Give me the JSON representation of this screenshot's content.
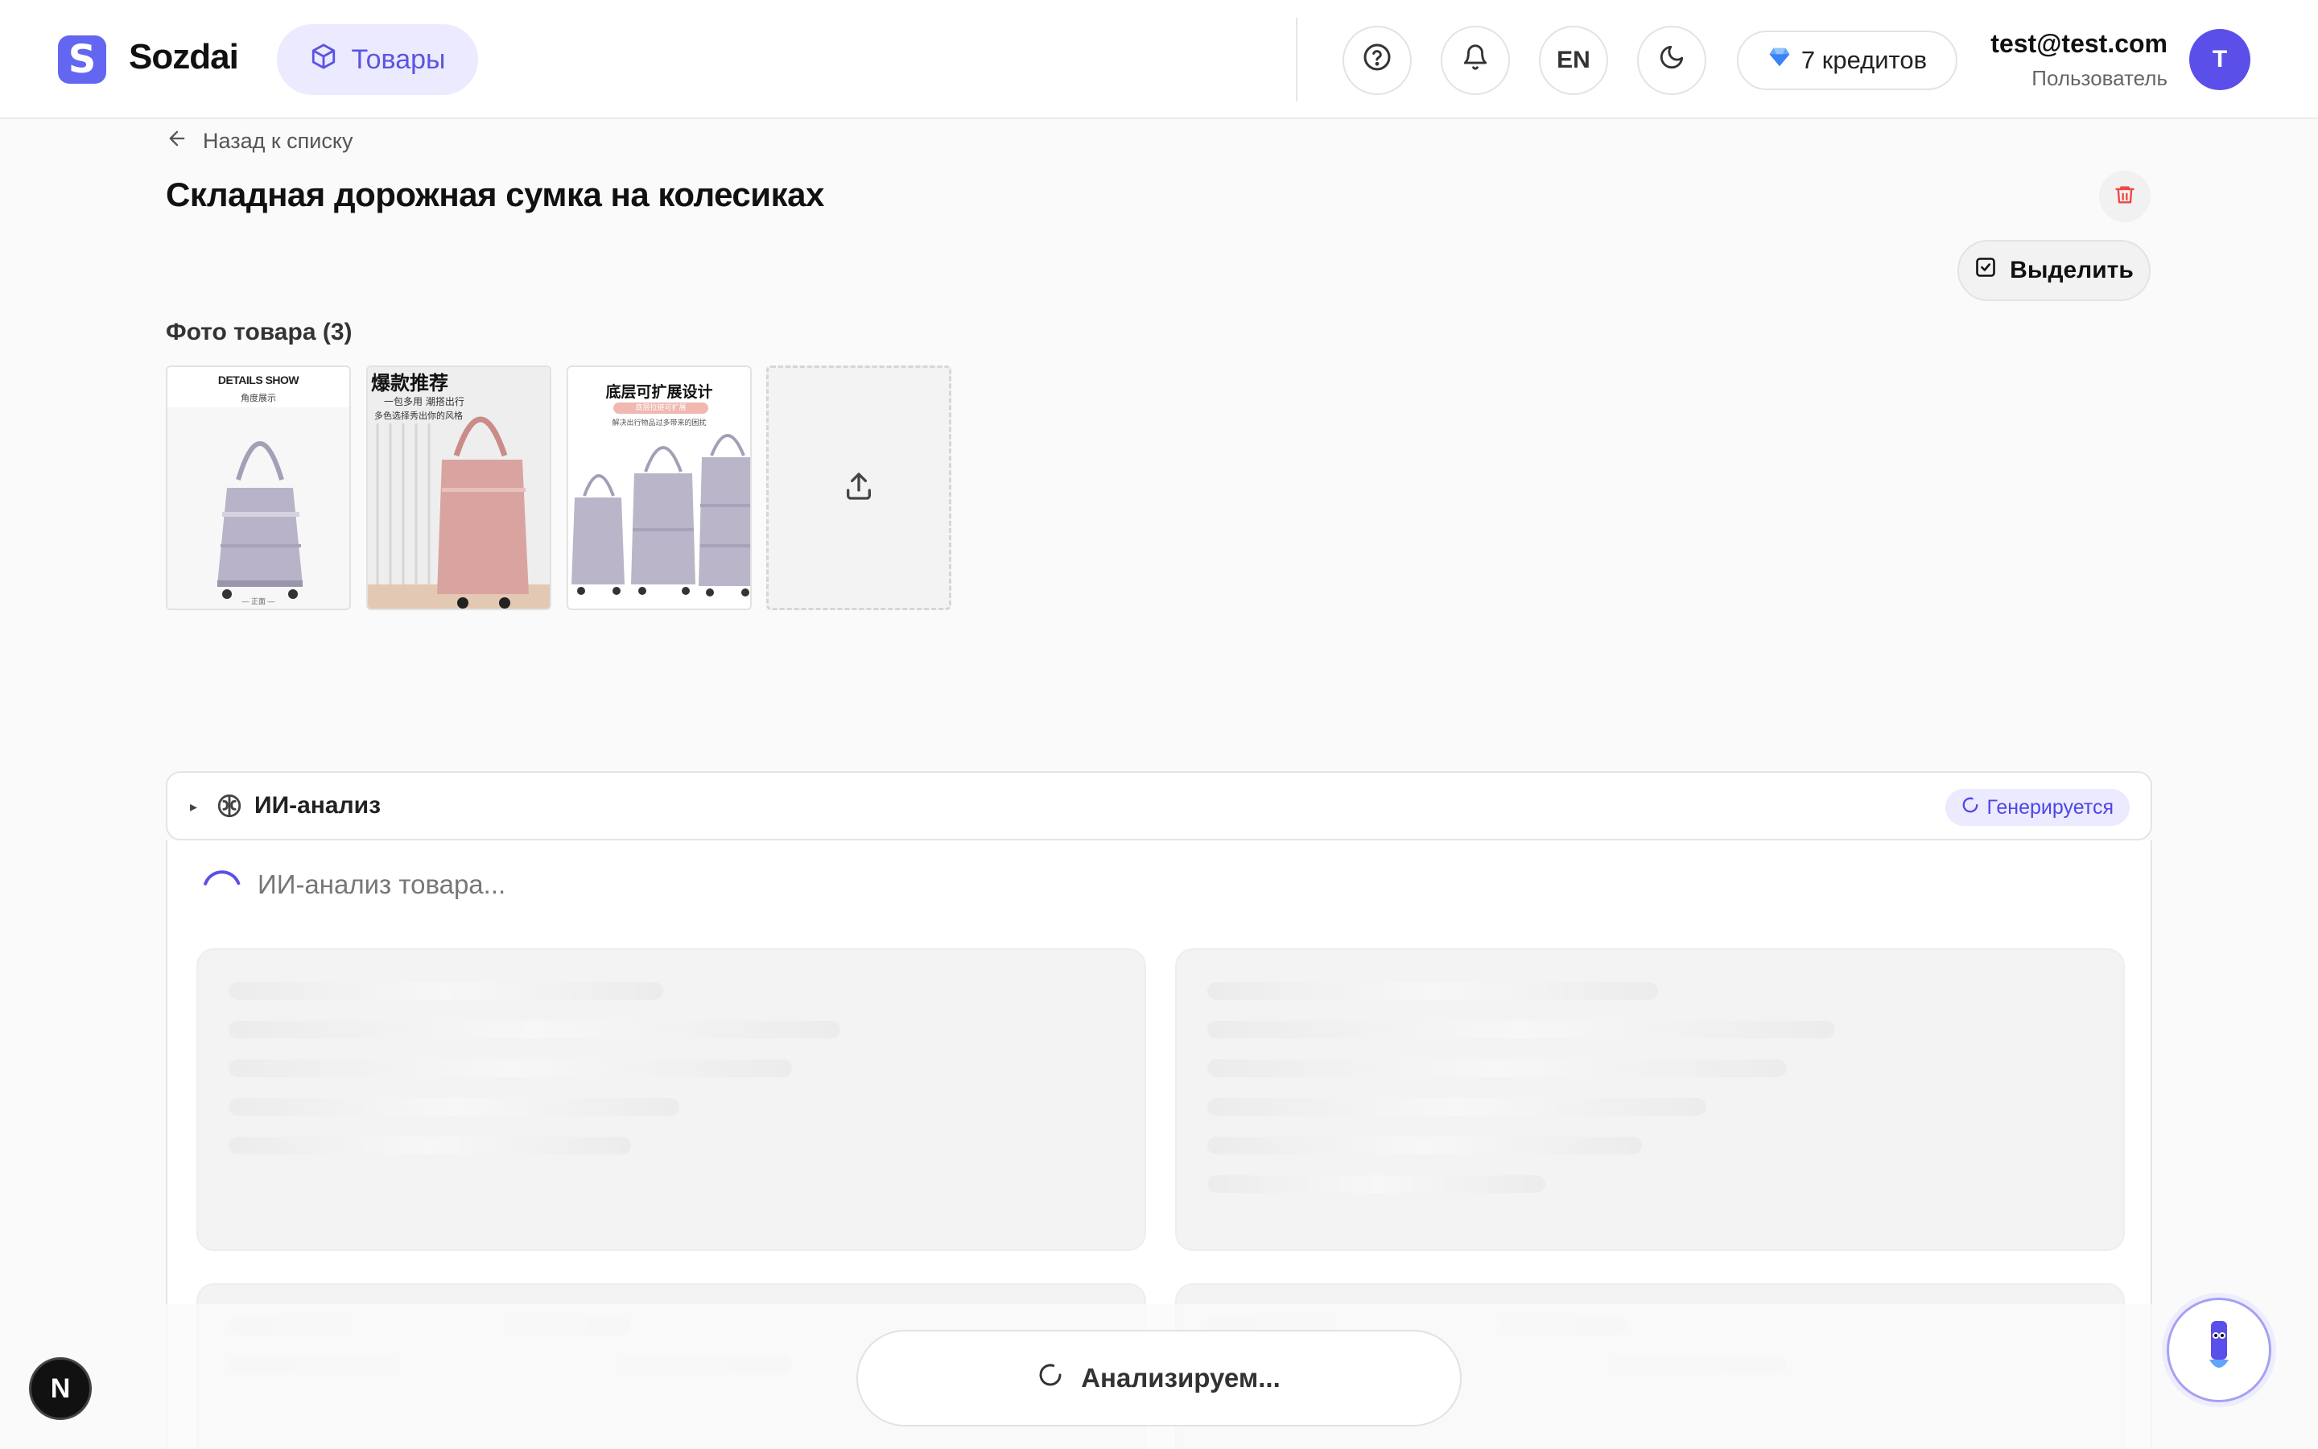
{
  "header": {
    "brand": "Sozdai",
    "logo_letter": "S",
    "nav_item": "Товары",
    "language": "EN",
    "credits": "7 кредитов",
    "user_email": "test@test.com",
    "user_role": "Пользователь",
    "avatar_initial": "T"
  },
  "product": {
    "back_label": "Назад к списку",
    "title": "Складная дорожная сумка на колесиках",
    "select_label": "Выделить",
    "photos_label": "Фото товара (3)",
    "photos": [
      {
        "caption_top": "DETAILS SHOW",
        "caption_sub": "角度展示",
        "caption_bottom": "— 正面 —",
        "bag_color": "#b9b3c9"
      },
      {
        "caption_top": "爆款推荐",
        "caption_sub": "一包多用 潮搭出行",
        "caption_sub2": "多色选择秀出你的风格",
        "bag_color": "#d9a4a0"
      },
      {
        "caption_top": "底层可扩展设计",
        "caption_sub": "底层拉链可扩展",
        "caption_sub2": "解决出行物品过多带来的困扰",
        "bag_color": "#bab5c8"
      }
    ]
  },
  "ai_panel": {
    "title": "ИИ-анализ",
    "status_badge": "Генерируется",
    "loading_text": "ИИ-анализ товара..."
  },
  "bottom": {
    "analyze_label": "Анализируем...",
    "next_badge": "N"
  },
  "colors": {
    "accent": "#6366f1",
    "accent_soft": "#ebeaff",
    "danger": "#ef4444"
  }
}
